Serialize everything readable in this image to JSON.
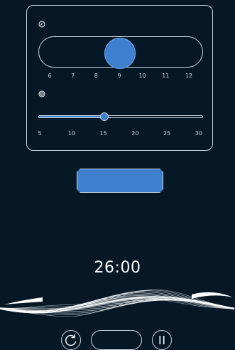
{
  "hours_slider": {
    "icon": "clock-icon",
    "ticks": [
      "6",
      "7",
      "8",
      "9",
      "10",
      "11",
      "12"
    ],
    "min": 6,
    "max": 12,
    "value": 9
  },
  "minutes_slider": {
    "icon": "target-icon",
    "ticks": [
      "5",
      "10",
      "15",
      "20",
      "25",
      "30"
    ],
    "min": 5,
    "max": 30,
    "value": 15
  },
  "start_button": {
    "label": ""
  },
  "timer": {
    "display": "26:00"
  },
  "controls": {
    "reset_icon": "reset-icon",
    "middle_label": "",
    "pause_icon": "pause-icon"
  },
  "colors": {
    "background": "#061826",
    "accent": "#3f7fd0",
    "outline": "#c9d4dd"
  }
}
